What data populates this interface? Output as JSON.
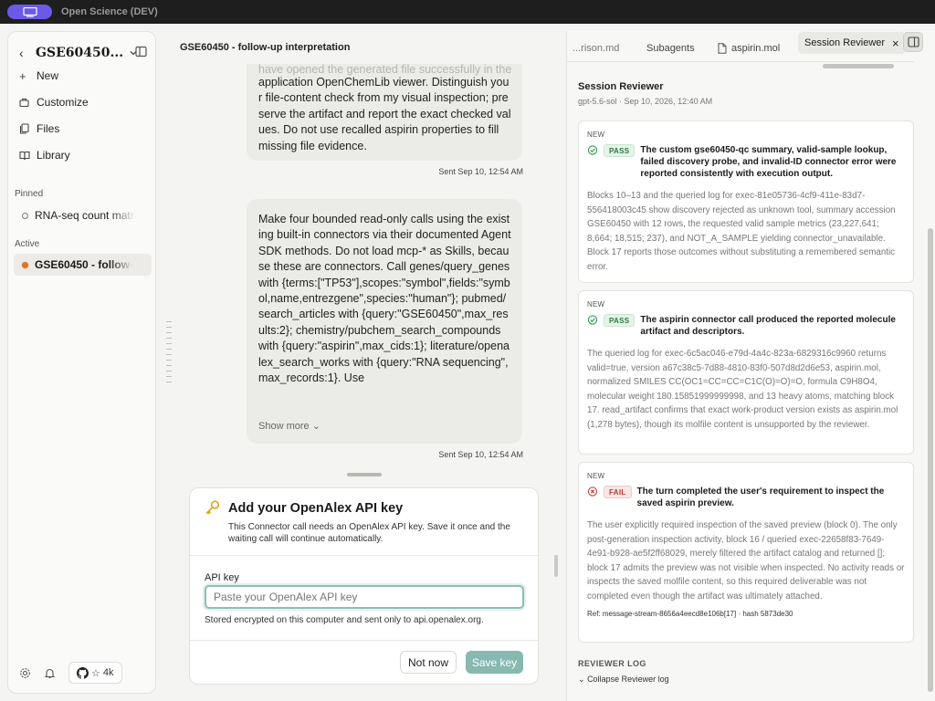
{
  "app": {
    "title": "Open Science (DEV)"
  },
  "sidebar": {
    "project_title": "GSE60450...",
    "items": [
      {
        "label": "New",
        "icon": "plus-icon"
      },
      {
        "label": "Customize",
        "icon": "briefcase-icon"
      },
      {
        "label": "Files",
        "icon": "files-icon"
      },
      {
        "label": "Library",
        "icon": "book-icon"
      }
    ],
    "pinned_label": "Pinned",
    "pinned": [
      {
        "label": "RNA-seq count matri"
      }
    ],
    "active_label": "Active",
    "active": [
      {
        "label": "GSE60450 - follow-"
      }
    ],
    "github_stars": "4k"
  },
  "conversation": {
    "title": "GSE60450 - follow-up interpretation",
    "messages": [
      {
        "ghost_text": "have opened the generated file successfully in the",
        "text": "application OpenChemLib viewer. Distinguish your file-content check from my visual inspection; preserve the artifact and report the exact checked values. Do not use recalled aspirin properties to fill missing file evidence.",
        "timestamp": "Sent Sep 10, 12:54 AM"
      },
      {
        "text": "Make four bounded read-only calls using the existing built-in connectors via their documented Agent SDK methods. Do not load mcp-* as Skills, because these are connectors. Call genes/query_genes with {terms:[\"TP53\"],scopes:\"symbol\",fields:\"symbol,name,entrezgene\",species:\"human\"}; pubmed/search_articles with {query:\"GSE60450\",max_results:2}; chemistry/pubchem_search_compounds with {query:\"aspirin\",max_cids:1}; literature/openalex_search_works with {query:\"RNA sequencing\",max_records:1}. Use",
        "show_more": "Show more",
        "timestamp": "Sent Sep 10, 12:54 AM"
      }
    ]
  },
  "api_key_card": {
    "title": "Add your OpenAlex API key",
    "description": "This Connector call needs an OpenAlex API key. Save it once and the waiting call will continue automatically.",
    "field_label": "API key",
    "placeholder": "Paste your OpenAlex API key",
    "value": "",
    "hint": "Stored encrypted on this computer and sent only to api.openalex.org.",
    "cancel_label": "Not now",
    "save_label": "Save key"
  },
  "right_panel": {
    "tabs": [
      {
        "label": "...rison.md"
      },
      {
        "label": "Subagents"
      },
      {
        "label": "aspirin.mol",
        "icon": "file-icon"
      },
      {
        "label": "Session Reviewer",
        "active": true
      }
    ],
    "reviewer": {
      "title": "Session Reviewer",
      "subtitle": "gpt-5.6-sol · Sep 10, 2026, 12:40 AM"
    },
    "findings": [
      {
        "tag": "NEW",
        "status": "PASS",
        "status_icon": "check-circle-icon",
        "headline": "The custom gse60450-qc summary, valid-sample lookup, failed discovery probe, and invalid-ID connector error were reported consistently with execution output.",
        "body": "Blocks 10–13 and the queried log for exec-81e05736-4cf9-411e-83d7-556418003c45 show discovery rejected as unknown tool, summary accession GSE60450 with 12 rows, the requested valid sample metrics (23,227,641; 8,664; 18,515; 237), and NOT_A_SAMPLE yielding connector_unavailable. Block 17 reports those outcomes without substituting a remembered semantic error."
      },
      {
        "tag": "NEW",
        "status": "PASS",
        "status_icon": "check-circle-icon",
        "headline": "The aspirin connector call produced the reported molecule artifact and descriptors.",
        "body": "The queried log for exec-6c5ac046-e79d-4a4c-823a-6829316c9960 returns valid=true, version a67c38c5-7d88-4810-83f0-507d8d2d6e53, aspirin.mol, normalized SMILES CC(OC1=CC=CC=C1C(O)=O)=O, formula C9H8O4, molecular weight 180.15851999999998, and 13 heavy atoms, matching block 17. read_artifact confirms that exact work-product version exists as aspirin.mol (1,278 bytes), though its molfile content is unsupported by the reviewer."
      },
      {
        "tag": "NEW",
        "status": "FAIL",
        "status_icon": "x-circle-icon",
        "headline": "The turn completed the user's requirement to inspect the saved aspirin preview.",
        "body": "The user explicitly required inspection of the saved preview (block 0). The only post-generation inspection activity, block 16 / queried exec-22658f83-7649-4e91-b928-ae5f2ff68029, merely filtered the artifact catalog and returned []; block 17 admits the preview was not visible when inspected. No activity reads or inspects the saved molfile content, so this required deliverable was not completed even though the artifact was ultimately attached.",
        "ref": "Ref: message-stream-8656a4eecd8e106b[17] · hash 5873de30"
      }
    ],
    "log": {
      "title": "REVIEWER LOG",
      "collapse_label": "Collapse Reviewer log"
    }
  },
  "colors": {
    "accent": "#6b5ae8",
    "pass": "#2f7a43",
    "fail": "#b73a31",
    "save_button": "#86b9b0",
    "active_dot": "#d4762c"
  }
}
